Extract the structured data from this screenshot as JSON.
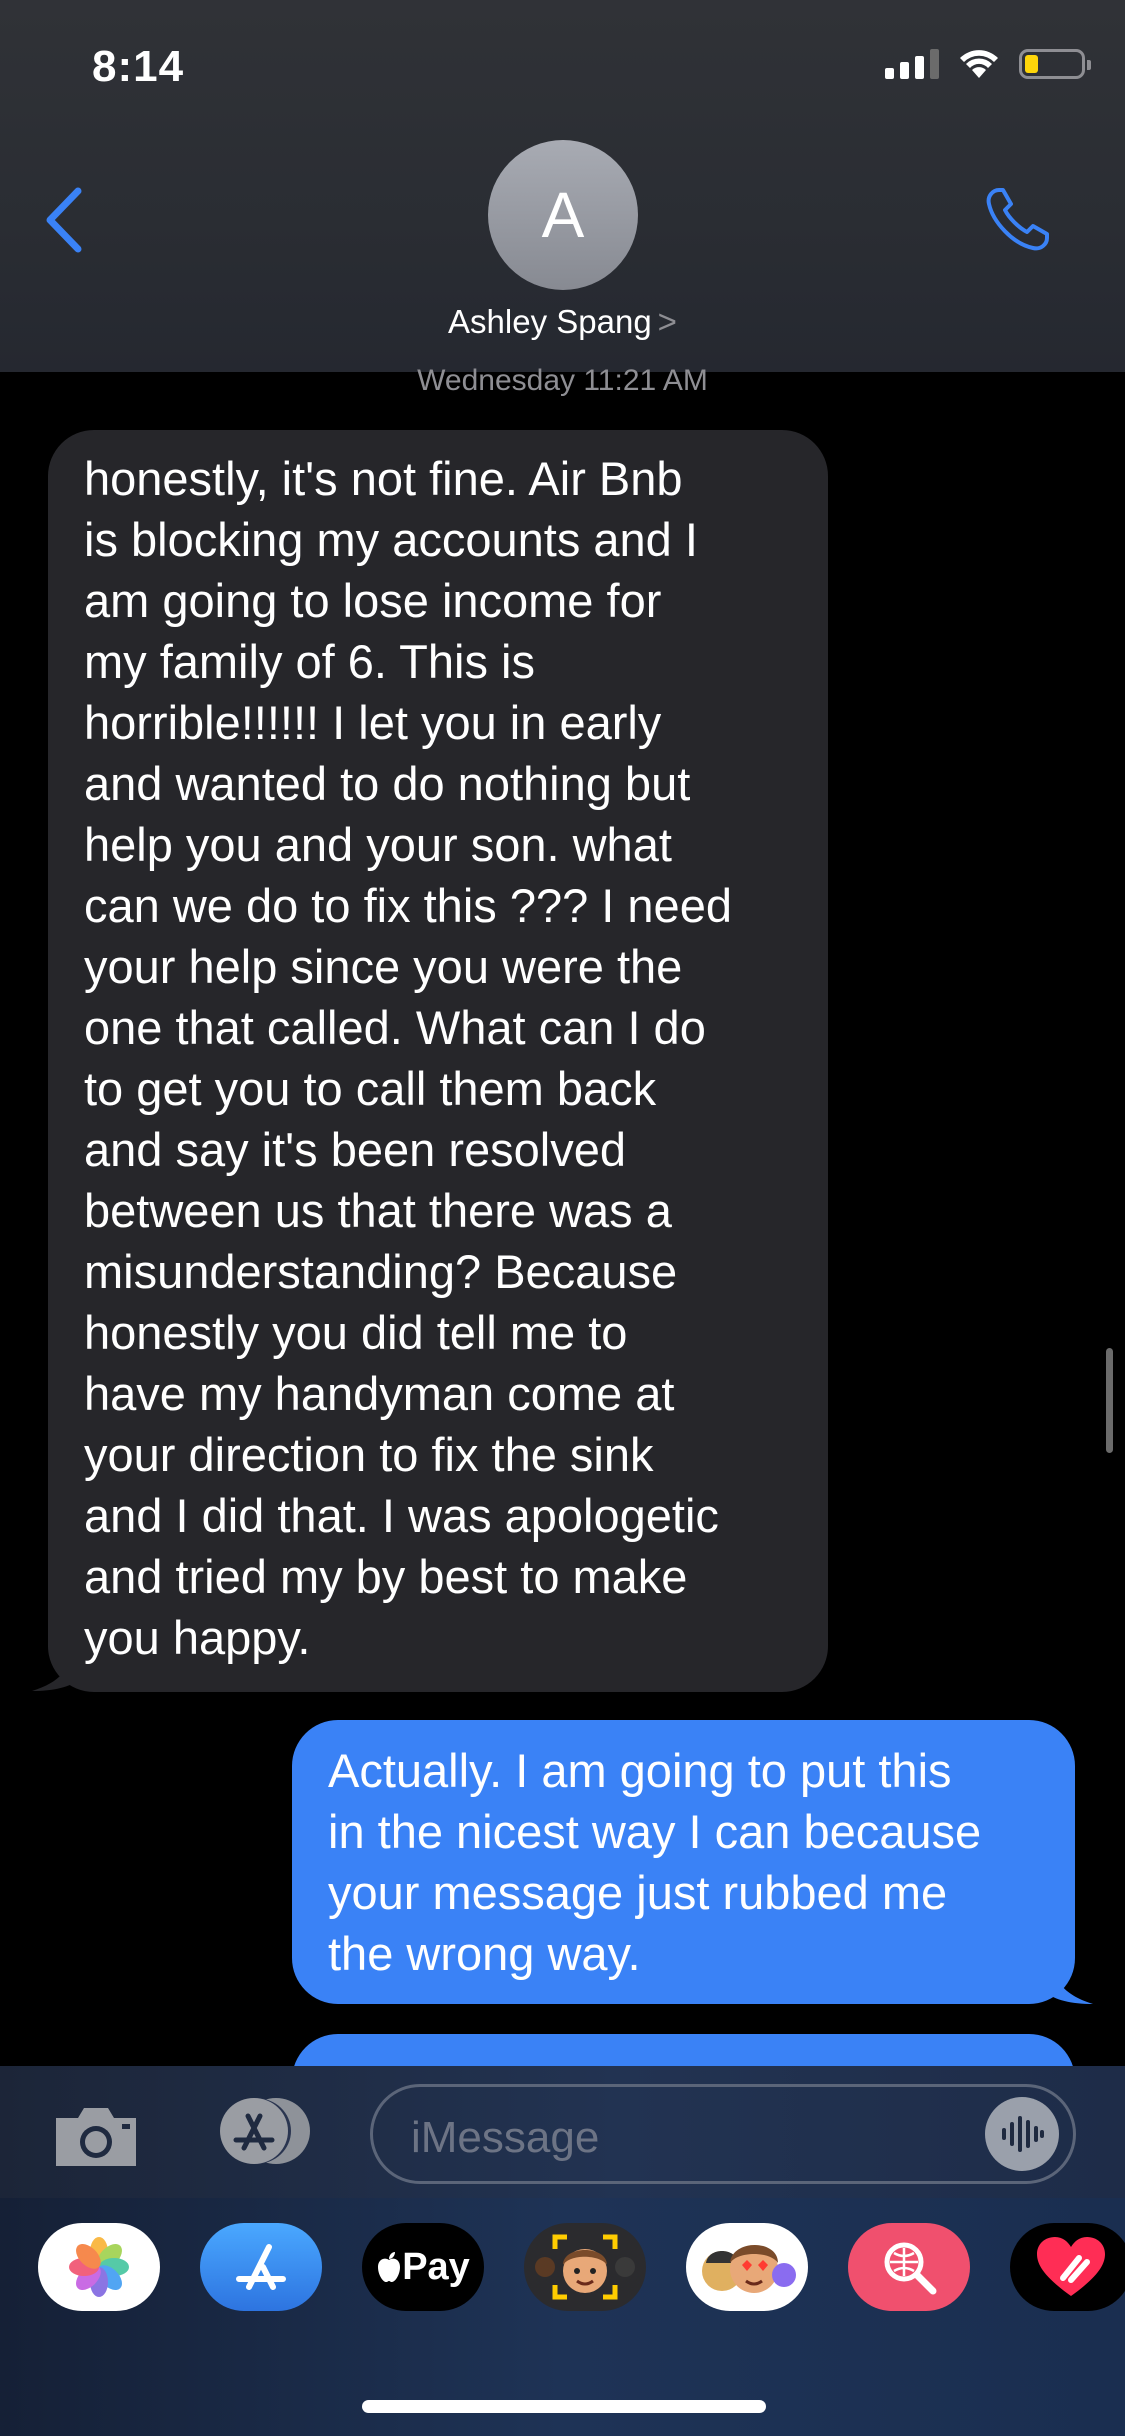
{
  "status_bar": {
    "time": "8:14"
  },
  "header": {
    "avatar_initial": "A",
    "contact_name": "Ashley Spang",
    "chevron": ">"
  },
  "conversation": {
    "timestamp": "Wednesday 11:21 AM",
    "messages": [
      {
        "direction": "incoming",
        "text": "honestly, it's not fine. Air Bnb\nis blocking my accounts and I\nam going to lose income for\nmy family of 6. This is\nhorrible!!!!!! I let you in early\nand wanted to do nothing but\nhelp you and your son. what\ncan we do to fix this ??? I need\nyour help since you were the\none that called. What can I do\nto get you to call them back\nand say it's been resolved\nbetween us that there was a\nmisunderstanding? Because\nhonestly you did tell me to\nhave my handyman come at\nyour direction to fix the sink\nand I did that. I was apologetic\nand tried my by best to make\nyou happy."
      },
      {
        "direction": "outgoing",
        "text": "Actually. I am going to put this\nin the nicest way I can because\nyour message just rubbed me\nthe wrong way."
      }
    ]
  },
  "compose": {
    "placeholder": "iMessage"
  },
  "app_drawer": {
    "apple_pay_label": "Pay",
    "apps": [
      "photos-icon",
      "app-store-icon",
      "apple-pay-icon",
      "memoji-icon",
      "animoji-stickers-icon",
      "image-search-icon",
      "digital-touch-icon"
    ]
  },
  "colors": {
    "incoming_bubble": "#26262a",
    "outgoing_bubble": "#3a82f6",
    "accent": "#3a82f6",
    "background": "#000000"
  }
}
